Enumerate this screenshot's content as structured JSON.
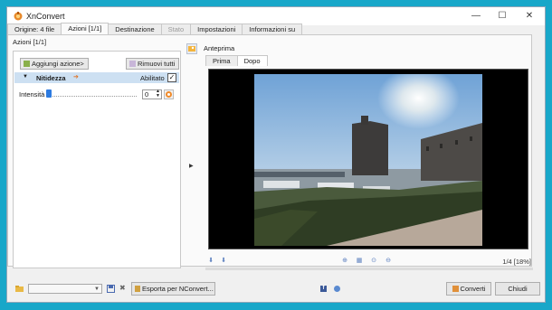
{
  "window": {
    "title": "XnConvert",
    "minimize_glyph": "—",
    "maximize_glyph": "☐",
    "close_glyph": "✕"
  },
  "tabs": [
    {
      "label": "Origine: 4 file"
    },
    {
      "label": "Azioni [1/1]"
    },
    {
      "label": "Destinazione"
    },
    {
      "label": "Stato"
    },
    {
      "label": "Impostazioni"
    },
    {
      "label": "Informazioni su"
    }
  ],
  "actions_panel": {
    "label": "Azioni [1/1]",
    "add_action_label": "Aggiungi azione>",
    "remove_all_label": "Rimuovi tutti",
    "action": {
      "name": "Nitidezza",
      "enabled_label": "Abilitato",
      "enabled": true
    },
    "intensity_label": "Intensità",
    "intensity_value": "0"
  },
  "preview": {
    "label": "Anteprima",
    "tabs": [
      {
        "label": "Prima"
      },
      {
        "label": "Dopo"
      }
    ],
    "page_indicator": "1/4 [18%]"
  },
  "bottom": {
    "export_label": "Esporta per NConvert...",
    "convert_label": "Converti",
    "close_label": "Chiudi"
  },
  "icons": {
    "app": "xnconvert-logo-icon",
    "preview": "preview-icon",
    "remove": "remove-icon",
    "add": "add-icon",
    "reset": "reset-icon",
    "folder": "folder-icon",
    "save": "save-icon",
    "delete": "delete-icon",
    "export": "export-icon",
    "convert": "convert-icon",
    "facebook": "facebook-icon",
    "help": "help-icon"
  },
  "colors": {
    "accent": "#2d7be0",
    "selected_row": "#cde0f2",
    "desktop": "#18a7c9"
  }
}
